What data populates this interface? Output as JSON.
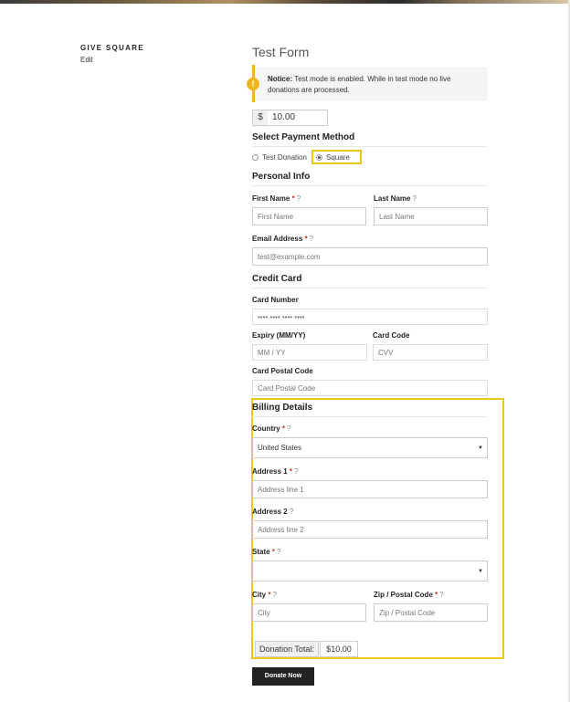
{
  "sidebar": {
    "title": "GIVE SQUARE",
    "edit_label": "Edit"
  },
  "form": {
    "title": "Test Form",
    "notice": {
      "label": "Notice:",
      "text": "Test mode is enabled. While in test mode no live donations are processed."
    },
    "amount": {
      "currency": "$",
      "value": "10.00"
    },
    "payment": {
      "heading": "Select Payment Method",
      "options": [
        {
          "label": "Test Donation",
          "selected": false
        },
        {
          "label": "Square",
          "selected": true
        }
      ]
    },
    "personal": {
      "heading": "Personal Info",
      "first_name": {
        "label": "First Name",
        "required": "*",
        "placeholder": "First Name"
      },
      "last_name": {
        "label": "Last Name",
        "placeholder": "Last Name"
      },
      "email": {
        "label": "Email Address",
        "required": "*",
        "placeholder": "test@example.com"
      }
    },
    "credit_card": {
      "heading": "Credit Card",
      "card_number": {
        "label": "Card Number",
        "placeholder": "•••• •••• •••• ••••"
      },
      "expiry": {
        "label": "Expiry (MM/YY)",
        "placeholder": "MM / YY"
      },
      "code": {
        "label": "Card Code",
        "placeholder": "CVV"
      },
      "postal": {
        "label": "Card Postal Code",
        "placeholder": "Card Postal Code"
      }
    },
    "billing": {
      "heading": "Billing Details",
      "country": {
        "label": "Country",
        "required": "*",
        "value": "United States"
      },
      "address1": {
        "label": "Address 1",
        "required": "*",
        "placeholder": "Address line 1"
      },
      "address2": {
        "label": "Address 2",
        "placeholder": "Address line 2"
      },
      "state": {
        "label": "State",
        "required": "*",
        "value": ""
      },
      "city": {
        "label": "City",
        "required": "*",
        "placeholder": "City"
      },
      "zip": {
        "label": "Zip / Postal Code",
        "required": "*",
        "placeholder": "Zip / Postal Code"
      }
    },
    "total": {
      "label": "Donation Total:",
      "value": "$10.00"
    },
    "submit_label": "Donate Now"
  },
  "icons": {
    "help": "?",
    "warning": "!",
    "chevron": "▼"
  },
  "colors": {
    "accent": "#f0b51f",
    "highlight": "#f0c419",
    "button": "#222222"
  }
}
